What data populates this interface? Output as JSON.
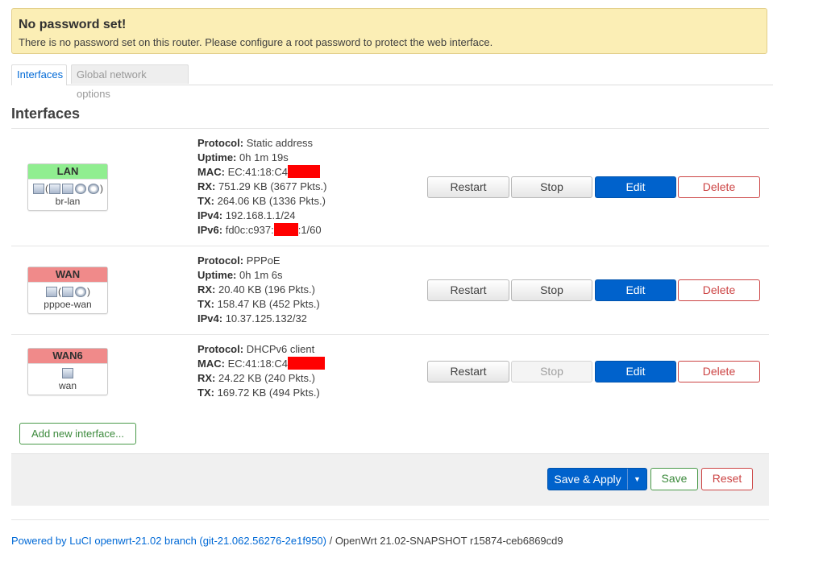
{
  "alert": {
    "title": "No password set!",
    "message": "There is no password set on this router. Please configure a root password to protect the web interface."
  },
  "tabs": [
    {
      "label": "Interfaces",
      "active": true
    },
    {
      "label": "Global network options",
      "active": false
    }
  ],
  "section_title": "Interfaces",
  "interfaces": [
    {
      "name": "LAN",
      "color": "#90ee90",
      "device": "br-lan",
      "icons": [
        "bridge-icon",
        "ethernet-port-icon",
        "ethernet-port-icon",
        "wifi-icon",
        "wifi-icon"
      ],
      "protocol": "Static address",
      "uptime": "0h 1m 19s",
      "mac": "EC:41:18:C4",
      "rx": "751.29 KB (3677 Pkts.)",
      "tx": "264.06 KB (1336 Pkts.)",
      "ipv4": "192.168.1.1/24",
      "ipv6_prefix": "fd0c:c937:",
      "ipv6_suffix": ":1/60"
    },
    {
      "name": "WAN",
      "color": "#f08a8a",
      "device": "pppoe-wan",
      "icons": [
        "tunnel-icon",
        "ethernet-port-icon",
        "wifi-icon"
      ],
      "protocol": "PPPoE",
      "uptime": "0h 1m 6s",
      "rx": "20.40 KB (196 Pkts.)",
      "tx": "158.47 KB (452 Pkts.)",
      "ipv4": "10.37.125.132/32"
    },
    {
      "name": "WAN6",
      "color": "#f08a8a",
      "device": "wan",
      "icons": [
        "ethernet-port-icon"
      ],
      "protocol": "DHCPv6 client",
      "mac": "EC:41:18:C4",
      "rx": "24.22 KB (240 Pkts.)",
      "tx": "169.72 KB (494 Pkts.)"
    }
  ],
  "labels": {
    "protocol": "Protocol:",
    "uptime": "Uptime:",
    "mac": "MAC:",
    "rx": "RX:",
    "tx": "TX:",
    "ipv4": "IPv4:",
    "ipv6": "IPv6:"
  },
  "row_buttons": {
    "restart": "Restart",
    "stop": "Stop",
    "edit": "Edit",
    "delete": "Delete"
  },
  "add_interface": "Add new interface...",
  "footer_buttons": {
    "save_apply": "Save & Apply",
    "save": "Save",
    "reset": "Reset"
  },
  "powered_by": {
    "link_text": "Powered by LuCI openwrt-21.02 branch (git-21.062.56276-2e1f950)",
    "rest": " / OpenWrt 21.02-SNAPSHOT r15874-ceb6869cd9"
  },
  "colors": {
    "accent_blue": "#0062cc",
    "link_blue": "#0069d6",
    "delete_red": "#cc4444",
    "save_green": "#3c8a3c",
    "redaction": "#ff0000"
  }
}
